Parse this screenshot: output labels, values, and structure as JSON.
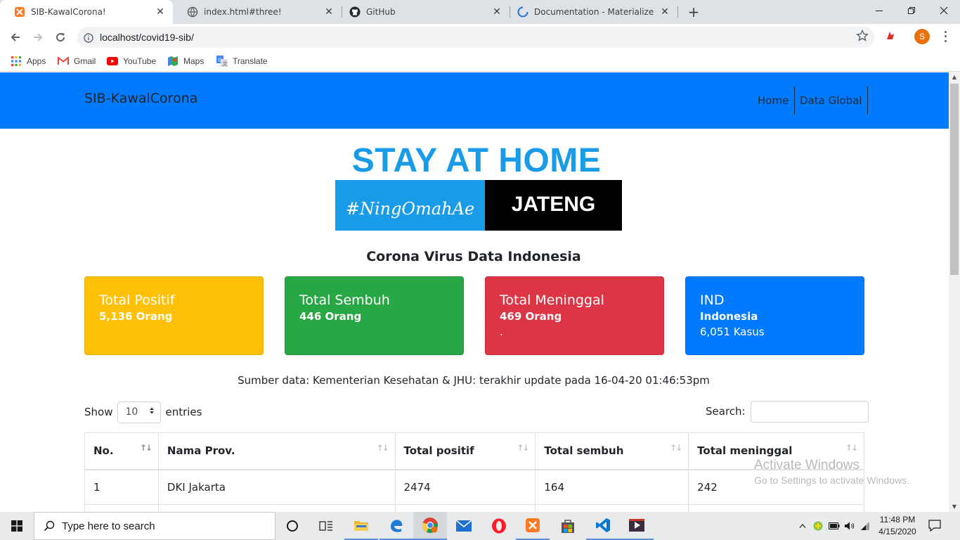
{
  "browser": {
    "tabs": [
      {
        "title": "SIB-KawalCorona!",
        "favicon": "xampp-icon",
        "active": true
      },
      {
        "title": "index.html#three!",
        "favicon": "globe-icon",
        "active": false
      },
      {
        "title": "GitHub",
        "favicon": "github-icon",
        "active": false
      },
      {
        "title": "Documentation - Materialize",
        "favicon": "loading-icon",
        "active": false
      }
    ],
    "new_tab": "+",
    "url": "localhost/covid19-sib/",
    "profile_initial": "S",
    "bookmarks": [
      {
        "label": "Apps",
        "icon": "apps-grid-icon"
      },
      {
        "label": "Gmail",
        "icon": "gmail-icon"
      },
      {
        "label": "YouTube",
        "icon": "youtube-icon"
      },
      {
        "label": "Maps",
        "icon": "maps-icon"
      },
      {
        "label": "Translate",
        "icon": "translate-icon"
      }
    ]
  },
  "site": {
    "brand": "SIB-KawalCorona",
    "nav": [
      "Home",
      "Data Global"
    ],
    "banner": {
      "title": "STAY AT HOME",
      "left": "#NingOmahAe",
      "right": "JATENG",
      "colors": {
        "blue": "#1a9be8",
        "black": "#000000"
      }
    },
    "section_title": "Corona Virus Data Indonesia",
    "cards": [
      {
        "title": "Total Positif",
        "value": "5,136 Orang",
        "extra": "",
        "color": "#ffc107"
      },
      {
        "title": "Total Sembuh",
        "value": "446 Orang",
        "extra": "",
        "color": "#28a745"
      },
      {
        "title": "Total Meninggal",
        "value": "469 Orang",
        "extra": ".",
        "color": "#dc3545"
      },
      {
        "title": "IND",
        "value": "Indonesia",
        "extra": "6,051 Kasus",
        "color": "#007bff"
      }
    ],
    "source_note": "Sumber data: Kementerian Kesehatan & JHU: terakhir update pada 16-04-20 01:46:53pm",
    "length": {
      "show": "Show",
      "value": "10",
      "entries": "entries"
    },
    "search_label": "Search:",
    "table": {
      "headers": [
        "No.",
        "Nama Prov.",
        "Total positif",
        "Total sembuh",
        "Total meninggal"
      ],
      "rows": [
        [
          "1",
          "DKI Jakarta",
          "2474",
          "164",
          "242"
        ],
        [
          "",
          "",
          "",
          "",
          ""
        ]
      ]
    },
    "navbar_color": "#007bff"
  },
  "watermark": {
    "title": "Activate Windows",
    "subtitle": "Go to Settings to activate Windows."
  },
  "taskbar": {
    "search_placeholder": "Type here to search",
    "apps": [
      "cortana-icon",
      "task-view-icon",
      "file-explorer-icon",
      "edge-icon",
      "chrome-icon",
      "mail-icon",
      "opera-icon",
      "xampp-icon",
      "store-icon",
      "vscode-icon",
      "media-player-icon"
    ],
    "time": "11:48 PM",
    "date": "4/15/2020"
  }
}
